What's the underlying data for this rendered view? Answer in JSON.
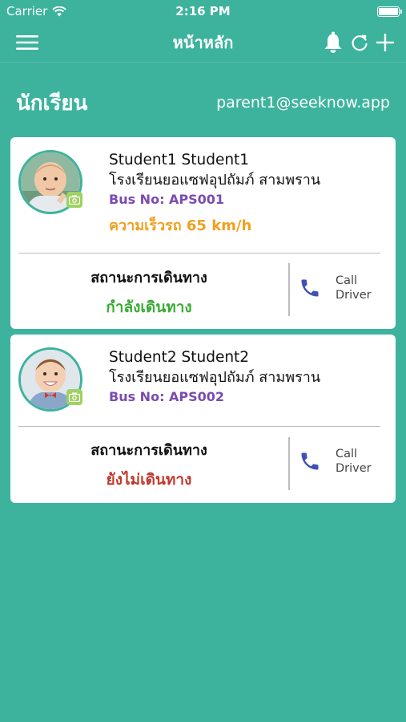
{
  "status_bar": {
    "carrier": "Carrier",
    "time": "2:16 PM"
  },
  "nav": {
    "title": "หน้าหลัก",
    "icons": [
      "menu-icon",
      "bell-icon",
      "refresh-icon",
      "add-icon"
    ]
  },
  "header": {
    "title": "นักเรียน",
    "email": "parent1@seeknow.app"
  },
  "students": [
    {
      "name": "Student1 Student1",
      "school": "โรงเรียนยอแซฟอุปถัมภ์ สามพราน",
      "bus": "Bus No: APS001",
      "speed": "ความเร็วรถ 65 km/h",
      "status_label": "สถานะการเดินทาง",
      "status_value": "กำลังเดินทาง",
      "status_color": "#3aaa35",
      "call_line1": "Call",
      "call_line2": "Driver"
    },
    {
      "name": "Student2 Student2",
      "school": "โรงเรียนยอแซฟอุปถัมภ์ สามพราน",
      "bus": "Bus No: APS002",
      "status_label": "สถานะการเดินทาง",
      "status_value": "ยังไม่เดินทาง",
      "status_color": "#c0392b",
      "call_line1": "Call",
      "call_line2": "Driver"
    }
  ],
  "colors": {
    "background": "#3db39e",
    "bus": "#7b4bb0",
    "speed": "#f0a020",
    "phone": "#3f51b5"
  }
}
